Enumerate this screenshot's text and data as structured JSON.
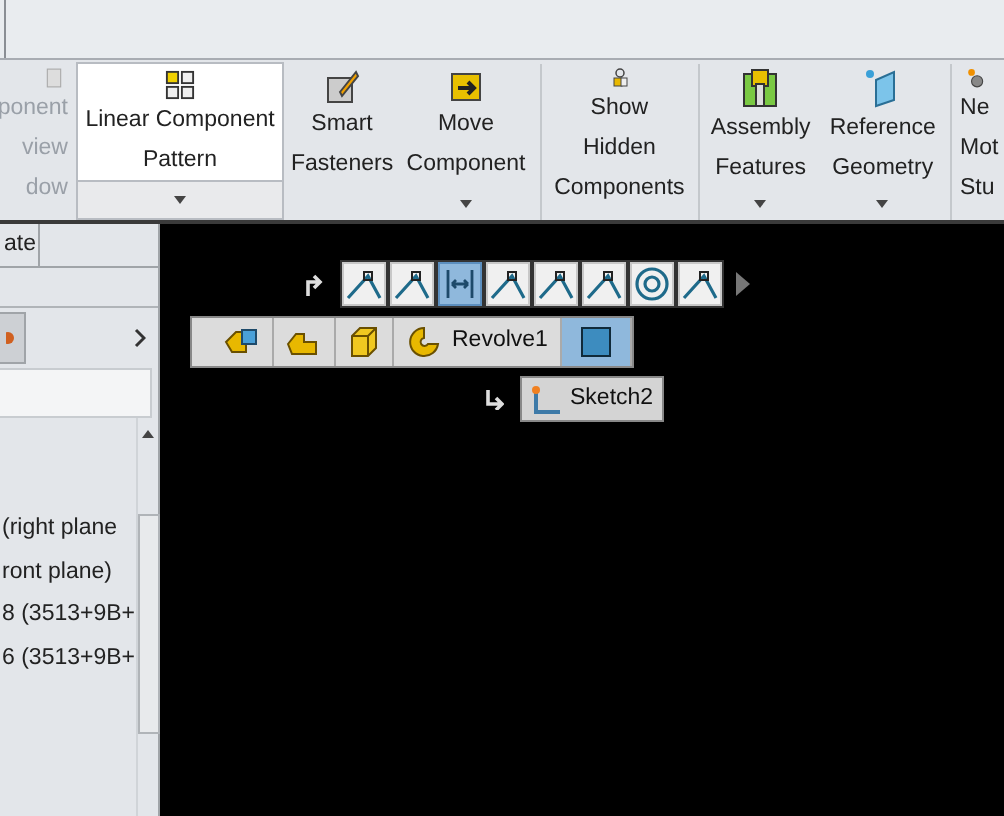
{
  "ribbon": [
    {
      "label": "ponent\nview\ndow",
      "kind": "plain",
      "disabled": true,
      "selected": false,
      "dropdown": false
    },
    {
      "label": "Linear Component\nPattern",
      "kind": "split",
      "disabled": false,
      "selected": true,
      "dropdown": true
    },
    {
      "label": "Smart\nFasteners",
      "kind": "plain",
      "disabled": false,
      "selected": false,
      "dropdown": false
    },
    {
      "label": "Move\nComponent",
      "kind": "plain",
      "disabled": false,
      "selected": false,
      "dropdown": true
    },
    {
      "label": "Show\nHidden\nComponents",
      "kind": "plain",
      "disabled": false,
      "selected": false,
      "dropdown": false
    },
    {
      "label": "Assembly\nFeatures",
      "kind": "plain",
      "disabled": false,
      "selected": false,
      "dropdown": true
    },
    {
      "label": "Reference\nGeometry",
      "kind": "plain",
      "disabled": false,
      "selected": false,
      "dropdown": true
    },
    {
      "label": "Ne\nMot\nStu",
      "kind": "plain",
      "disabled": false,
      "selected": false,
      "dropdown": false
    }
  ],
  "panel": {
    "tab": "ate",
    "tree_items": [
      "(right plane",
      "ront plane)",
      "8 (3513+9B+",
      "6 (3513+9B+"
    ]
  },
  "context_toolbar": [
    {
      "kind": "line",
      "selected": false
    },
    {
      "kind": "line",
      "selected": false
    },
    {
      "kind": "dimension",
      "selected": true
    },
    {
      "kind": "line",
      "selected": false
    },
    {
      "kind": "line",
      "selected": false
    },
    {
      "kind": "line",
      "selected": false
    },
    {
      "kind": "circle",
      "selected": false
    },
    {
      "kind": "line",
      "selected": false
    }
  ],
  "breadcrumb": [
    {
      "kind": "assembly",
      "selected": false
    },
    {
      "kind": "part",
      "selected": false
    },
    {
      "kind": "body",
      "selected": false
    },
    {
      "kind": "revolve",
      "label": "Revolve1",
      "selected": false
    },
    {
      "kind": "face",
      "selected": true
    }
  ],
  "sketch": {
    "label": "Sketch2"
  }
}
